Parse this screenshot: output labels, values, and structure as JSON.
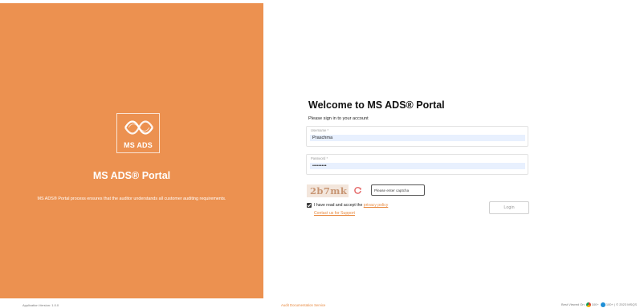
{
  "brand": {
    "logo_text": "MS ADS",
    "title": "MS ADS® Portal",
    "description": "MS ADS® Portal process ensures that the auditor understands all customer auditing requirements."
  },
  "login": {
    "heading": "Welcome to MS ADS® Portal",
    "subtitle": "Please sign in to your account",
    "username_label": "Username *",
    "username_value": "Praschma",
    "password_label": "Password *",
    "password_value": "Password1",
    "captcha_text": "2b7mk",
    "captcha_placeholder": "Please enter captcha",
    "agree_text": "I have read and accept the",
    "privacy_link": "privacy policy",
    "support_link": "Contact us for Support",
    "login_button": "Login",
    "agree_checked": true
  },
  "footer": {
    "version": "Application Version: 1.0.0",
    "service": "Audit Documentation Service",
    "best_viewed": "Best Viewed On",
    "chrome": "100+",
    "edge": "100+",
    "copyright": "| © 2023 MSQS"
  },
  "colors": {
    "accent": "#ec9150",
    "link": "#e8893f"
  },
  "icons": [
    "ms-ads-logo-icon",
    "refresh-icon",
    "checkbox-checked-icon",
    "chrome-icon",
    "edge-icon"
  ]
}
